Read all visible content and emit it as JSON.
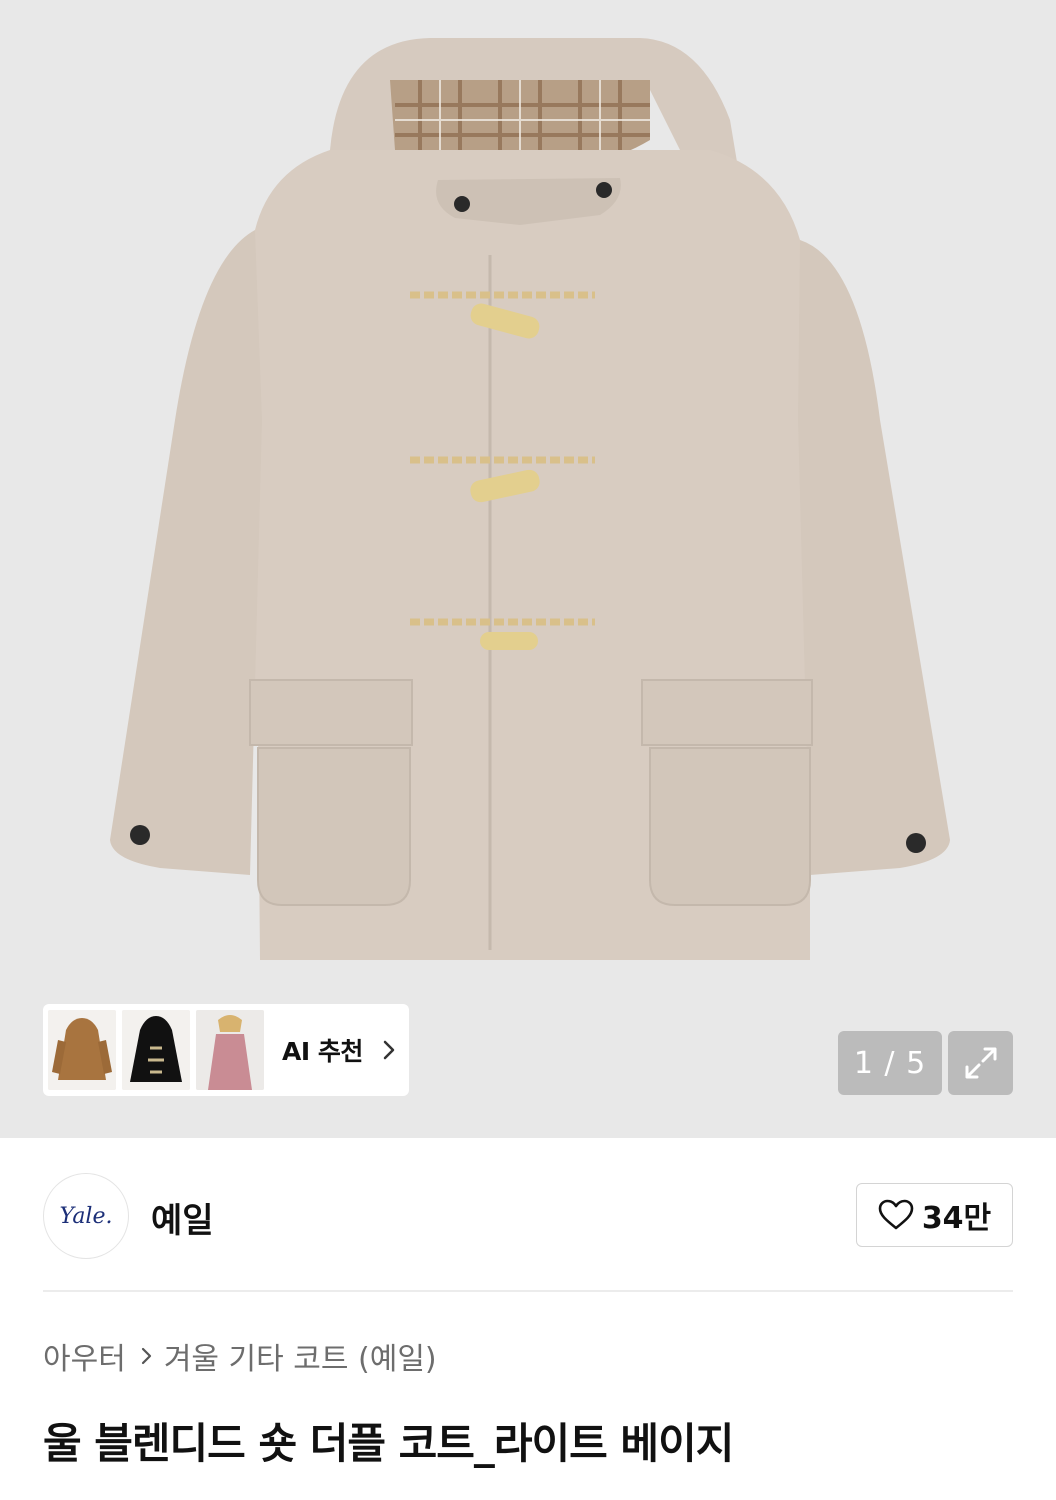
{
  "hero": {
    "image_alt": "울 블렌디드 숏 더플 코트_라이트 베이지",
    "pager": "1 / 5"
  },
  "ai_recommend": {
    "label": "AI 추천",
    "thumbnails": [
      "camel-duffle-coat",
      "black-hoodie",
      "pink-coat-model"
    ]
  },
  "brand": {
    "logo_text": "Yale.",
    "name": "예일",
    "like_count": "34만"
  },
  "breadcrumb": {
    "category": "아우터",
    "subcategory": "겨울 기타 코트 (예일)"
  },
  "product": {
    "title": "울 블렌디드 숏 더플 코트_라이트 베이지"
  },
  "colors": {
    "coat": "#d8ccc1",
    "hero_bg": "#e8e8e8",
    "brand_logo": "#1c2f78"
  }
}
